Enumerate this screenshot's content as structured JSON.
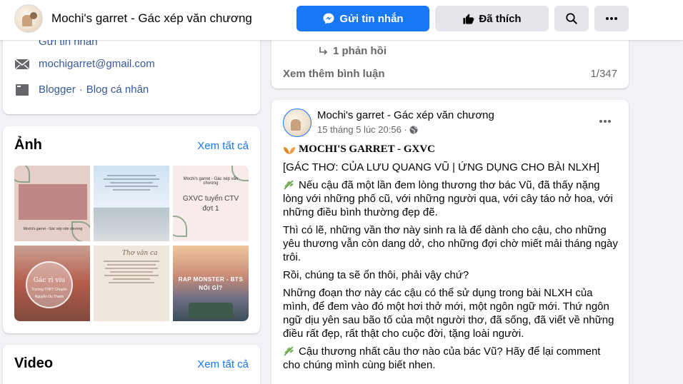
{
  "header": {
    "page_name": "Mochi's garret - Gác xép văn chương",
    "message_button": "Gửi tin nhắn",
    "liked_button": "Đã thích"
  },
  "intro": {
    "message_link": "Gửi tin nhắn",
    "email": "mochigarret@gmail.com",
    "blogger": "Blogger",
    "separator": "·",
    "blog_label": "Blog cá nhân"
  },
  "photos": {
    "title": "Ảnh",
    "see_all": "Xem tất cả",
    "tiles": [
      {
        "text": "Mochi's garret - Gác xép văn chương"
      },
      {
        "text": ""
      },
      {
        "text": "Mochi's garret - Gác xép văn chương",
        "big": "GXVC tuyển CTV đợt 1"
      },
      {
        "text": "Gác rì viu",
        "sub": "Trường THPT Chuyên Nguyễn Du Thanh"
      },
      {
        "text": "Thơ văn ca"
      },
      {
        "text": "RAP MONSTER - BTS NÓI GÌ?"
      }
    ]
  },
  "videos": {
    "title": "Video",
    "see_all": "Xem tất cả"
  },
  "comments": {
    "reply": "1 phản hồi",
    "see_more": "Xem thêm bình luận",
    "count": "1/347"
  },
  "post": {
    "author": "Mochi's garret - Gác xép văn chương",
    "time": "15 tháng 5 lúc 20:56 ·",
    "brand": "MOCHI'S GARRET - GXVC",
    "paragraphs": [
      "[GÁC THƠ: CỦA LƯU QUANG VŨ | ỨNG DỤNG CHO BÀI NLXH]",
      "Nếu cậu đã một lần đem lòng thương thơ bác Vũ, đã thấy nặng lòng với những phố cũ, với những người qua, với cây táo nở hoa, với những điều bình thường đẹp đẽ.",
      "Thì có lẽ, những vần thơ này sinh ra là để dành cho cậu, cho những yêu thương vẫn còn dang dở, cho những đợi chờ miết mải tháng ngày trôi.",
      "Rồi, chúng ta sẽ ổn thôi, phải vậy chứ?",
      "Những đoạn thơ này các cậu có thể sử dụng trong bài NLXH của mình, để đem vào đó một hơi thở mới, một ngôn ngữ mới. Thứ ngôn ngữ dịu yên sau bão tố của một người thơ, đã sống, đã viết về những điều rất đẹp, rất thật cho cuộc đời, tặng loài người.",
      "Cậu thương nhất câu thơ nào của bác Vũ? Hãy để lại comment cho chúng mình cùng biết nhen."
    ]
  },
  "colors": {
    "accent": "#1877f2",
    "link": "#385898",
    "muted": "#65676b",
    "background": "#f0f2f5"
  },
  "icons": [
    "messenger-icon",
    "thumbs-up-icon",
    "search-icon",
    "more-icon",
    "email-icon",
    "blogger-icon",
    "reply-arrow-icon",
    "globe-icon",
    "orange-leaf-icon",
    "sprig-icon"
  ]
}
